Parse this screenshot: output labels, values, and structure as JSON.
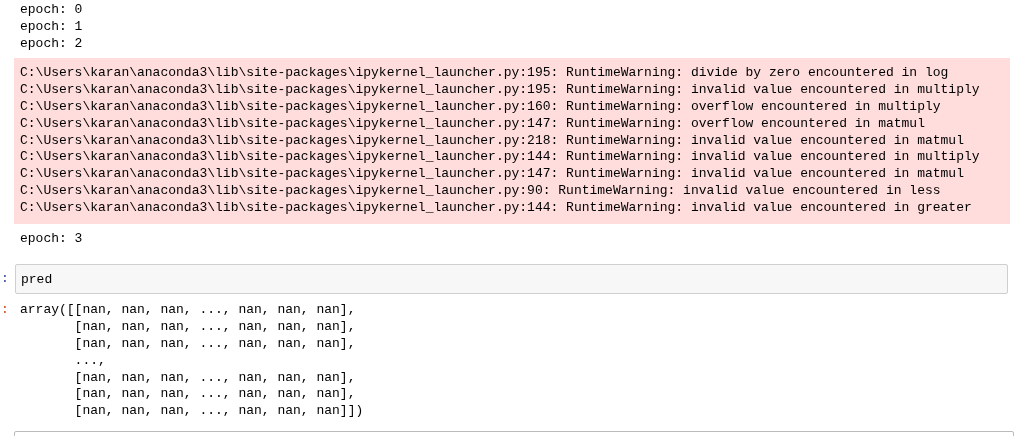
{
  "stdout_before": [
    "epoch: 0",
    "epoch: 1",
    "epoch: 2"
  ],
  "stderr": [
    "C:\\Users\\karan\\anaconda3\\lib\\site-packages\\ipykernel_launcher.py:195: RuntimeWarning: divide by zero encountered in log",
    "C:\\Users\\karan\\anaconda3\\lib\\site-packages\\ipykernel_launcher.py:195: RuntimeWarning: invalid value encountered in multiply",
    "C:\\Users\\karan\\anaconda3\\lib\\site-packages\\ipykernel_launcher.py:160: RuntimeWarning: overflow encountered in multiply",
    "C:\\Users\\karan\\anaconda3\\lib\\site-packages\\ipykernel_launcher.py:147: RuntimeWarning: overflow encountered in matmul",
    "C:\\Users\\karan\\anaconda3\\lib\\site-packages\\ipykernel_launcher.py:218: RuntimeWarning: invalid value encountered in matmul",
    "C:\\Users\\karan\\anaconda3\\lib\\site-packages\\ipykernel_launcher.py:144: RuntimeWarning: invalid value encountered in multiply",
    "C:\\Users\\karan\\anaconda3\\lib\\site-packages\\ipykernel_launcher.py:147: RuntimeWarning: invalid value encountered in matmul",
    "C:\\Users\\karan\\anaconda3\\lib\\site-packages\\ipykernel_launcher.py:90: RuntimeWarning: invalid value encountered in less",
    "C:\\Users\\karan\\anaconda3\\lib\\site-packages\\ipykernel_launcher.py:144: RuntimeWarning: invalid value encountered in greater"
  ],
  "stdout_after": [
    "epoch: 3"
  ],
  "input_cell": {
    "prompt": ":",
    "code": "pred"
  },
  "output_cell": {
    "prompt": ":",
    "lines": [
      "array([[nan, nan, nan, ..., nan, nan, nan],",
      "       [nan, nan, nan, ..., nan, nan, nan],",
      "       [nan, nan, nan, ..., nan, nan, nan],",
      "       ...,",
      "       [nan, nan, nan, ..., nan, nan, nan],",
      "       [nan, nan, nan, ..., nan, nan, nan],",
      "       [nan, nan, nan, ..., nan, nan, nan]])"
    ]
  }
}
